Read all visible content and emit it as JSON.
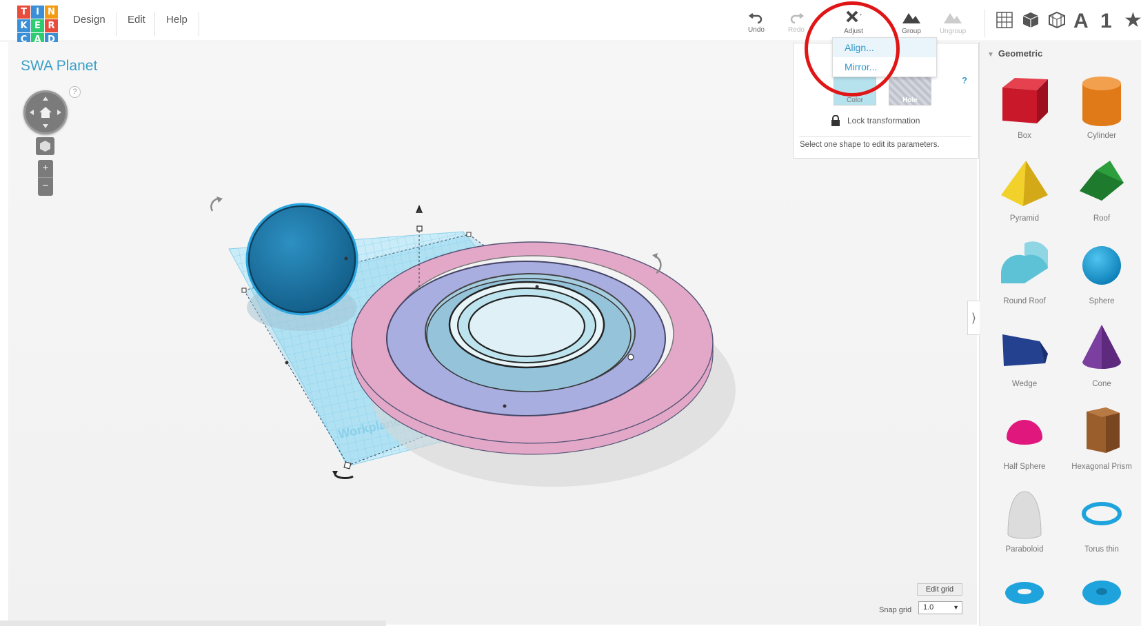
{
  "logo": {
    "letters": [
      "T",
      "I",
      "N",
      "K",
      "E",
      "R",
      "C",
      "A",
      "D"
    ]
  },
  "menu": {
    "design": "Design",
    "edit": "Edit",
    "help": "Help"
  },
  "toolbar": {
    "undo": "Undo",
    "redo": "Redo",
    "adjust": "Adjust",
    "group": "Group",
    "ungroup": "Ungroup"
  },
  "view_tools": {
    "text_label": "A",
    "number_label": "1"
  },
  "project": {
    "title": "SWA Planet"
  },
  "navigation": {
    "help": "?",
    "zoom_in": "+",
    "zoom_out": "−"
  },
  "adjust_menu": {
    "items": [
      "Align...",
      "Mirror..."
    ]
  },
  "inspector": {
    "color_label": "Color",
    "hole_label": "Hole",
    "help": "?",
    "lock_label": "Lock transformation",
    "message": "Select one shape to edit its parameters."
  },
  "workplane_label": "Workplane",
  "sidebar": {
    "category": "Geometric",
    "shapes": [
      "Box",
      "Cylinder",
      "Pyramid",
      "Roof",
      "Round Roof",
      "Sphere",
      "Wedge",
      "Cone",
      "Half Sphere",
      "Hexagonal Prism",
      "Paraboloid",
      "Torus thin"
    ]
  },
  "grid": {
    "edit_label": "Edit grid",
    "snap_label": "Snap grid",
    "snap_value": "1.0"
  },
  "colors": {
    "accent": "#3a9ec7",
    "highlight": "#e01515",
    "selection": "#2aa7e0"
  }
}
